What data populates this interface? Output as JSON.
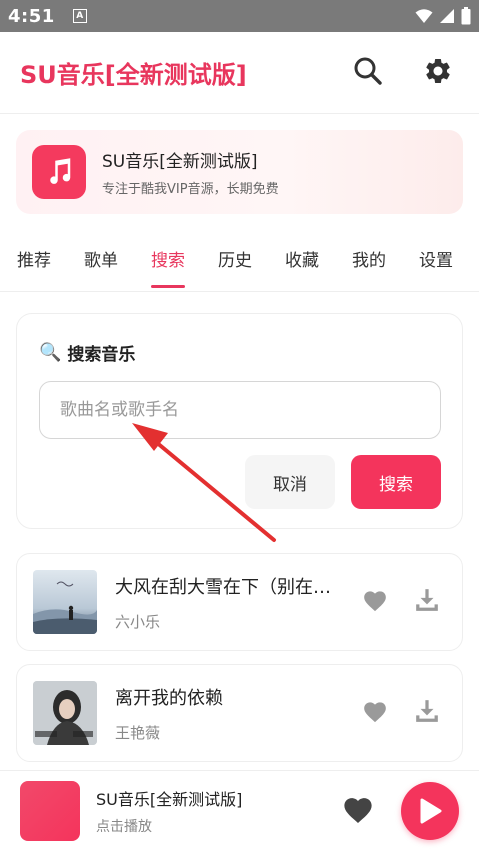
{
  "status_bar": {
    "time": "4:51",
    "notification_icon": "A"
  },
  "header": {
    "title": "SU音乐[全新测试版]",
    "icons": [
      "search-icon",
      "gear-icon"
    ]
  },
  "banner": {
    "title": "SU音乐[全新测试版]",
    "subtitle": "专注于酷我VIP音源，长期免费",
    "logo_icon": "music-note-icon"
  },
  "tabs": [
    {
      "label": "推荐"
    },
    {
      "label": "歌单"
    },
    {
      "label": "搜索",
      "active": true
    },
    {
      "label": "历史"
    },
    {
      "label": "收藏"
    },
    {
      "label": "我的"
    },
    {
      "label": "设置"
    }
  ],
  "search": {
    "heading": "搜索音乐",
    "heading_icon": "🔍",
    "placeholder": "歌曲名或歌手名",
    "value": "",
    "cancel_label": "取消",
    "search_label": "搜索"
  },
  "songs": [
    {
      "title": "大风在刮大雪在下（别在…",
      "artist": "六小乐"
    },
    {
      "title": "离开我的依赖",
      "artist": "王艳薇"
    }
  ],
  "player": {
    "title": "SU音乐[全新测试版]",
    "subtitle": "点击播放"
  },
  "colors": {
    "accent": "#e8365d",
    "button": "#f4345c",
    "status_bar": "#7a7a7a"
  }
}
